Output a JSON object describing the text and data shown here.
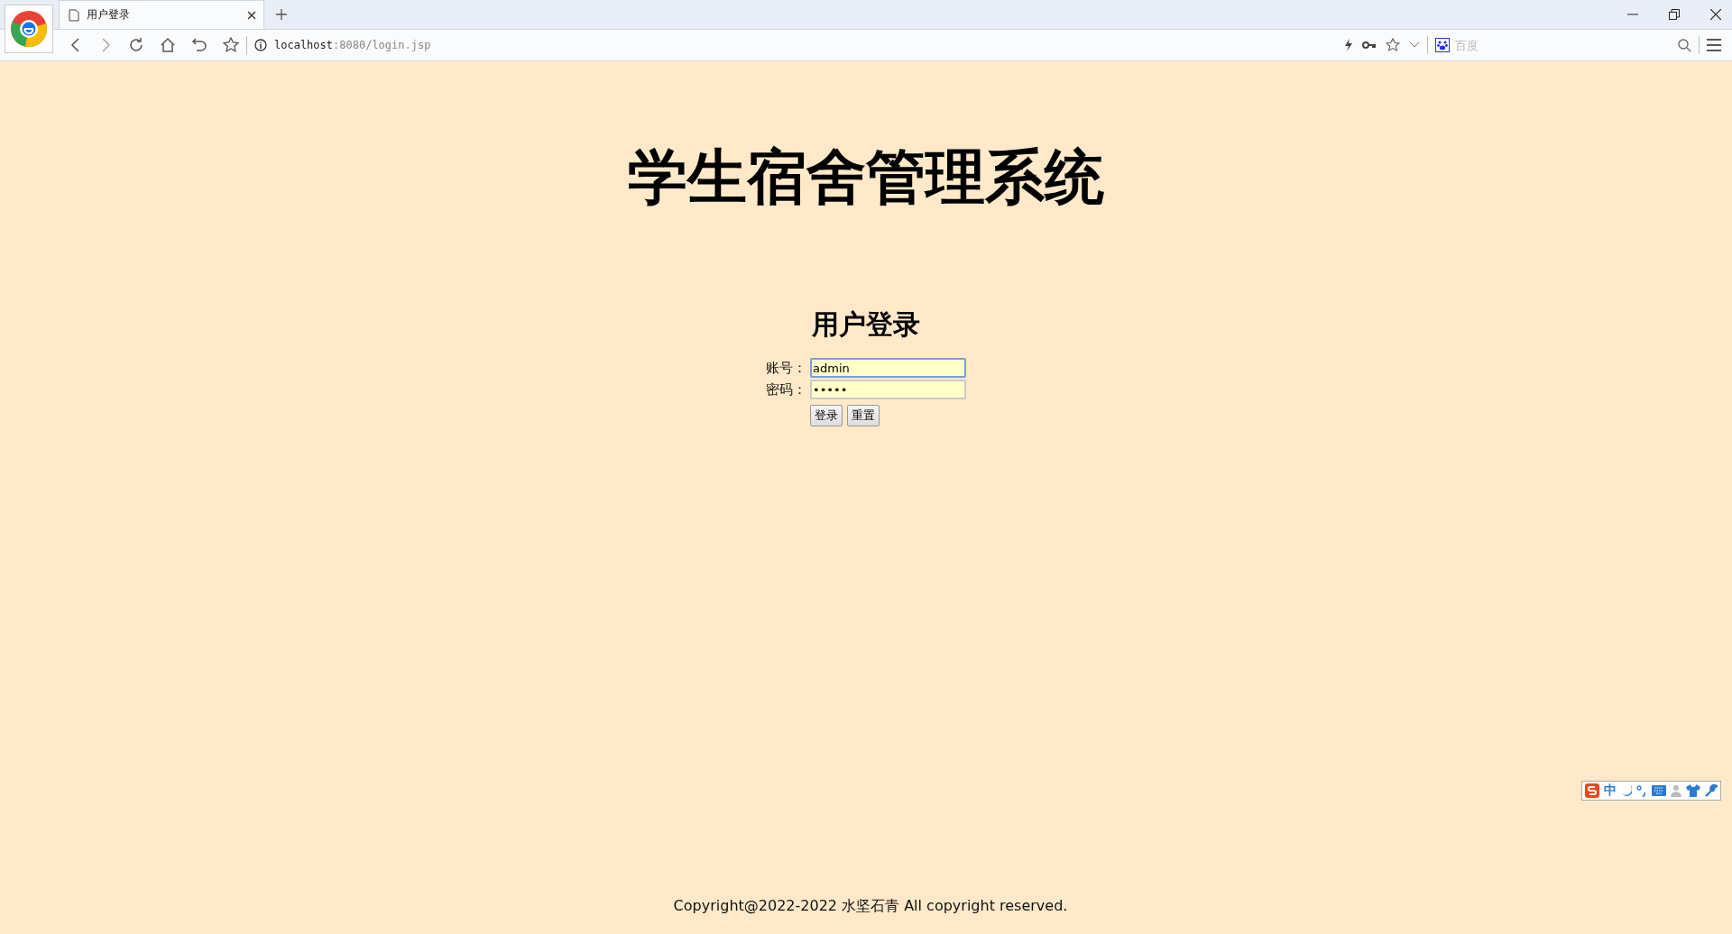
{
  "browser": {
    "tab": {
      "title": "用户登录",
      "selected": true
    },
    "address": {
      "host": "localhost",
      "rest": ":8080/login.jsp"
    },
    "search": {
      "placeholder": "百度"
    }
  },
  "page": {
    "title": "学生宿舍管理系统",
    "form_title": "用户登录",
    "fields": [
      {
        "label": "账号：",
        "value": "admin",
        "focused": true
      },
      {
        "label": "密码：",
        "value": "•••••",
        "focused": false
      }
    ],
    "buttons": [
      "登录",
      "重置"
    ],
    "copyright": "Copyright@2022-2022 水坚石青 All copyright reserved."
  },
  "ime_toolbar": {
    "mode": "中"
  }
}
